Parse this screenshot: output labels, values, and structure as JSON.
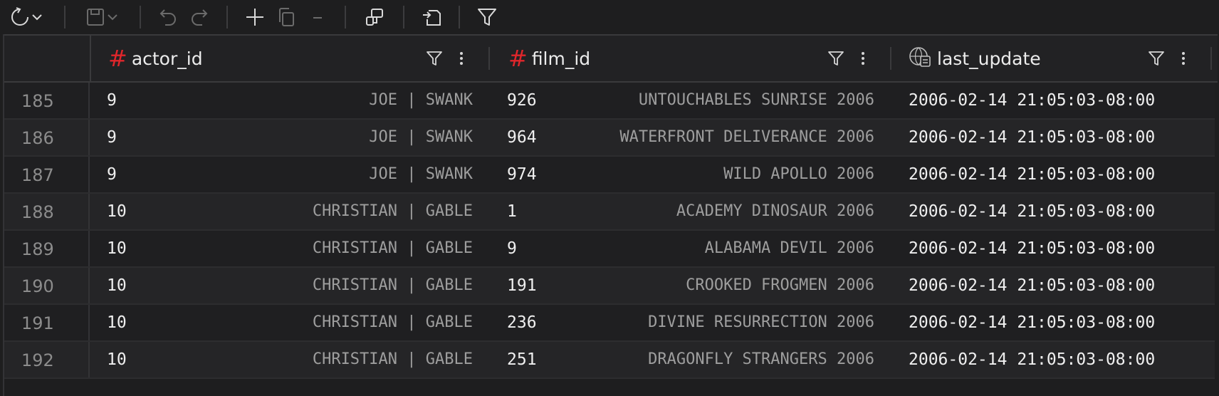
{
  "toolbar": {
    "items": [
      {
        "name": "refresh-icon",
        "enabled": true
      },
      {
        "name": "save-icon",
        "enabled": false
      },
      {
        "name": "undo-icon",
        "enabled": false
      },
      {
        "name": "redo-icon",
        "enabled": false
      },
      {
        "name": "add-row-icon",
        "enabled": true
      },
      {
        "name": "duplicate-row-icon",
        "enabled": false
      },
      {
        "name": "delete-row-icon",
        "enabled": false
      },
      {
        "name": "transform-icon",
        "enabled": true
      },
      {
        "name": "export-icon",
        "enabled": true
      },
      {
        "name": "filter-icon",
        "enabled": true
      }
    ]
  },
  "columns": [
    {
      "name": "actor_id",
      "type_icon": "hash-icon"
    },
    {
      "name": "film_id",
      "type_icon": "hash-icon"
    },
    {
      "name": "last_update",
      "type_icon": "timestamp-icon"
    }
  ],
  "rows": [
    {
      "num": "185",
      "actor_id": "9",
      "actor_ref": "JOE | SWANK",
      "film_id": "926",
      "film_ref": "UNTOUCHABLES SUNRISE 2006",
      "last_update": "2006-02-14 21:05:03-08:00"
    },
    {
      "num": "186",
      "actor_id": "9",
      "actor_ref": "JOE | SWANK",
      "film_id": "964",
      "film_ref": "WATERFRONT DELIVERANCE 2006",
      "last_update": "2006-02-14 21:05:03-08:00"
    },
    {
      "num": "187",
      "actor_id": "9",
      "actor_ref": "JOE | SWANK",
      "film_id": "974",
      "film_ref": "WILD APOLLO 2006",
      "last_update": "2006-02-14 21:05:03-08:00"
    },
    {
      "num": "188",
      "actor_id": "10",
      "actor_ref": "CHRISTIAN | GABLE",
      "film_id": "1",
      "film_ref": "ACADEMY DINOSAUR 2006",
      "last_update": "2006-02-14 21:05:03-08:00"
    },
    {
      "num": "189",
      "actor_id": "10",
      "actor_ref": "CHRISTIAN | GABLE",
      "film_id": "9",
      "film_ref": "ALABAMA DEVIL 2006",
      "last_update": "2006-02-14 21:05:03-08:00"
    },
    {
      "num": "190",
      "actor_id": "10",
      "actor_ref": "CHRISTIAN | GABLE",
      "film_id": "191",
      "film_ref": "CROOKED FROGMEN 2006",
      "last_update": "2006-02-14 21:05:03-08:00"
    },
    {
      "num": "191",
      "actor_id": "10",
      "actor_ref": "CHRISTIAN | GABLE",
      "film_id": "236",
      "film_ref": "DIVINE RESURRECTION 2006",
      "last_update": "2006-02-14 21:05:03-08:00"
    },
    {
      "num": "192",
      "actor_id": "10",
      "actor_ref": "CHRISTIAN | GABLE",
      "film_id": "251",
      "film_ref": "DRAGONFLY STRANGERS 2006",
      "last_update": "2006-02-14 21:05:03-08:00"
    }
  ]
}
